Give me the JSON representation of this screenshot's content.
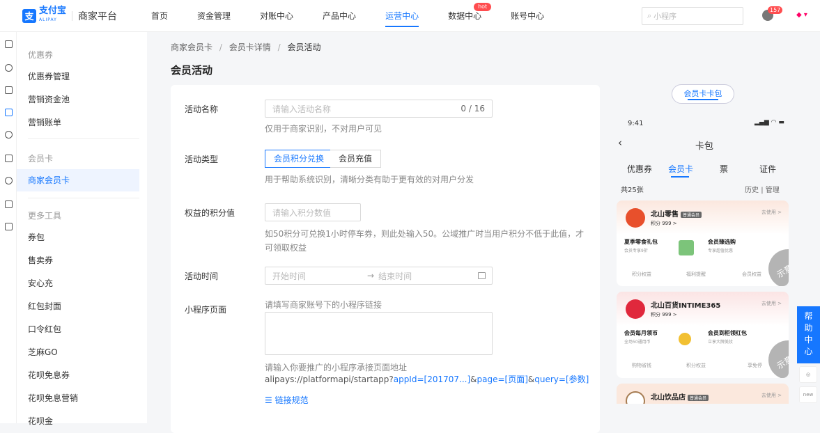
{
  "header": {
    "logo_cn": "支付宝",
    "logo_en": "ALIPAY",
    "platform": "商家平台",
    "nav": [
      "首页",
      "资金管理",
      "对账中心",
      "产品中心",
      "运营中心",
      "数据中心",
      "账号中心"
    ],
    "hot": "hot",
    "search_placeholder": "小程序",
    "badge": "157"
  },
  "sidebar": {
    "g1": "优惠券",
    "i1": "优惠券管理",
    "i2": "营销资金池",
    "i3": "营销账单",
    "g2": "会员卡",
    "i4": "商家会员卡",
    "g3": "更多工具",
    "i5": "券包",
    "i6": "售卖券",
    "i7": "安心充",
    "i8": "红包封面",
    "i9": "口令红包",
    "i10": "芝麻GO",
    "i11": "花呗免息券",
    "i12": "花呗免息营销",
    "i13": "花呗金"
  },
  "breadcrumb": {
    "a": "商家会员卡",
    "b": "会员卡详情",
    "c": "会员活动",
    "sep": "/"
  },
  "page_title": "会员活动",
  "form": {
    "name_label": "活动名称",
    "name_placeholder": "请输入活动名称",
    "name_count": "0 / 16",
    "name_hint": "仅用于商家识别，不对用户可见",
    "type_label": "活动类型",
    "type_opt1": "会员积分兑换",
    "type_opt2": "会员充值",
    "type_hint": "用于帮助系统识别，清晰分类有助于更有效的对用户分发",
    "points_label": "权益的积分值",
    "points_placeholder": "请输入积分数值",
    "points_hint": "如50积分可兑换1小时停车券，则此处输入50。公域推广时当用户积分不低于此值，才可领取权益",
    "time_label": "活动时间",
    "time_start": "开始时间",
    "time_arrow": "→",
    "time_end": "结束时间",
    "mp_label": "小程序页面",
    "mp_placeholder": "请填写商家账号下的小程序链接",
    "mp_hint": "请输入你要推广的小程序承接页面地址",
    "mp_url_pre": "alipays://platformapi/startapp?",
    "mp_url_appid": "appId=[201707...]",
    "mp_amp1": "&",
    "mp_url_page": "page=[页面]",
    "mp_amp2": "&",
    "mp_url_query": "query=[参数]",
    "mp_rule_link": "链接规范"
  },
  "preview": {
    "pill": "会员卡卡包",
    "time": "9:41",
    "title": "卡包",
    "tabs": [
      "优惠券",
      "会员卡",
      "票",
      "证件"
    ],
    "count": "共25张",
    "history": "历史",
    "sep": "|",
    "manage": "管理",
    "stamp": "示意图",
    "c1": {
      "name": "北山零售",
      "tag": "普通会员",
      "pts": "积分 999 >",
      "go": "去使用 >",
      "box1t": "夏季零食礼包",
      "box1s": "会员专享9折",
      "box2t": "会员臻选购",
      "box2s": "专享超值优惠",
      "f1": "积分权益",
      "f2": "福利提醒",
      "f3": "会员权益"
    },
    "c2": {
      "name": "北山百货INTIME365",
      "pts": "积分 999 >",
      "go": "去使用 >",
      "box1t": "会员每月领币",
      "box1s": "全场50通用币",
      "box2t": "会员到柜领红包",
      "box2s": "立享大牌美妆",
      "f1": "购物省钱",
      "f2": "积分权益",
      "f3": "享免停"
    },
    "c3": {
      "name": "北山饮品店",
      "tag": "普通会员",
      "go": "去使用 >"
    }
  },
  "help": "帮助中心",
  "help_new": "new"
}
